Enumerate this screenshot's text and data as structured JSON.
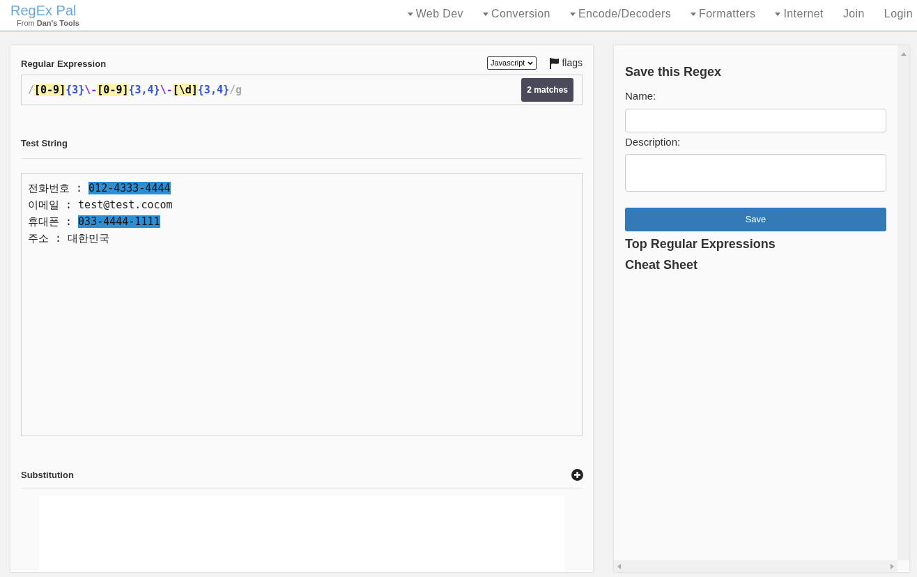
{
  "brand": {
    "title": "RegEx Pal",
    "subtitle_prefix": "From ",
    "subtitle_strong": "Dan's Tools"
  },
  "nav": [
    {
      "label": "Web Dev",
      "kind": "dropdown"
    },
    {
      "label": "Conversion",
      "kind": "dropdown"
    },
    {
      "label": "Encode/Decoders",
      "kind": "dropdown"
    },
    {
      "label": "Formatters",
      "kind": "dropdown"
    },
    {
      "label": "Internet",
      "kind": "dropdown"
    },
    {
      "label": "Join",
      "kind": "link"
    },
    {
      "label": "Login",
      "kind": "link"
    }
  ],
  "regex": {
    "heading": "Regular Expression",
    "flavor": "Javascript",
    "flags_label": "flags",
    "match_count": "2 matches",
    "tokens": [
      {
        "text": "/",
        "kind": "delimiter"
      },
      {
        "text": "[0-9]",
        "kind": "class"
      },
      {
        "text": "{3}",
        "kind": "quantifier"
      },
      {
        "text": "\\-",
        "kind": "escape"
      },
      {
        "text": "[0-9]",
        "kind": "class"
      },
      {
        "text": "{3,4}",
        "kind": "quantifier"
      },
      {
        "text": "\\-",
        "kind": "escape"
      },
      {
        "text": "[\\d]",
        "kind": "class"
      },
      {
        "text": "{3,4}",
        "kind": "quantifier"
      },
      {
        "text": "/g",
        "kind": "delimiter"
      }
    ]
  },
  "test_string": {
    "heading": "Test String",
    "lines": [
      [
        {
          "text": "전화번호 : ",
          "match": false
        },
        {
          "text": "012-4333-4444",
          "match": true
        }
      ],
      [
        {
          "text": "이메일 : test@test.cocom",
          "match": false
        }
      ],
      [
        {
          "text": "휴대폰 : ",
          "match": false
        },
        {
          "text": "033-4444-1111",
          "match": true
        }
      ],
      [
        {
          "text": "주소 : 대한민국",
          "match": false
        }
      ]
    ]
  },
  "substitution": {
    "heading": "Substitution"
  },
  "save_panel": {
    "heading": "Save this Regex",
    "name_label": "Name:",
    "description_label": "Description:",
    "save_button": "Save",
    "links": [
      "Top Regular Expressions",
      "Cheat Sheet"
    ]
  }
}
